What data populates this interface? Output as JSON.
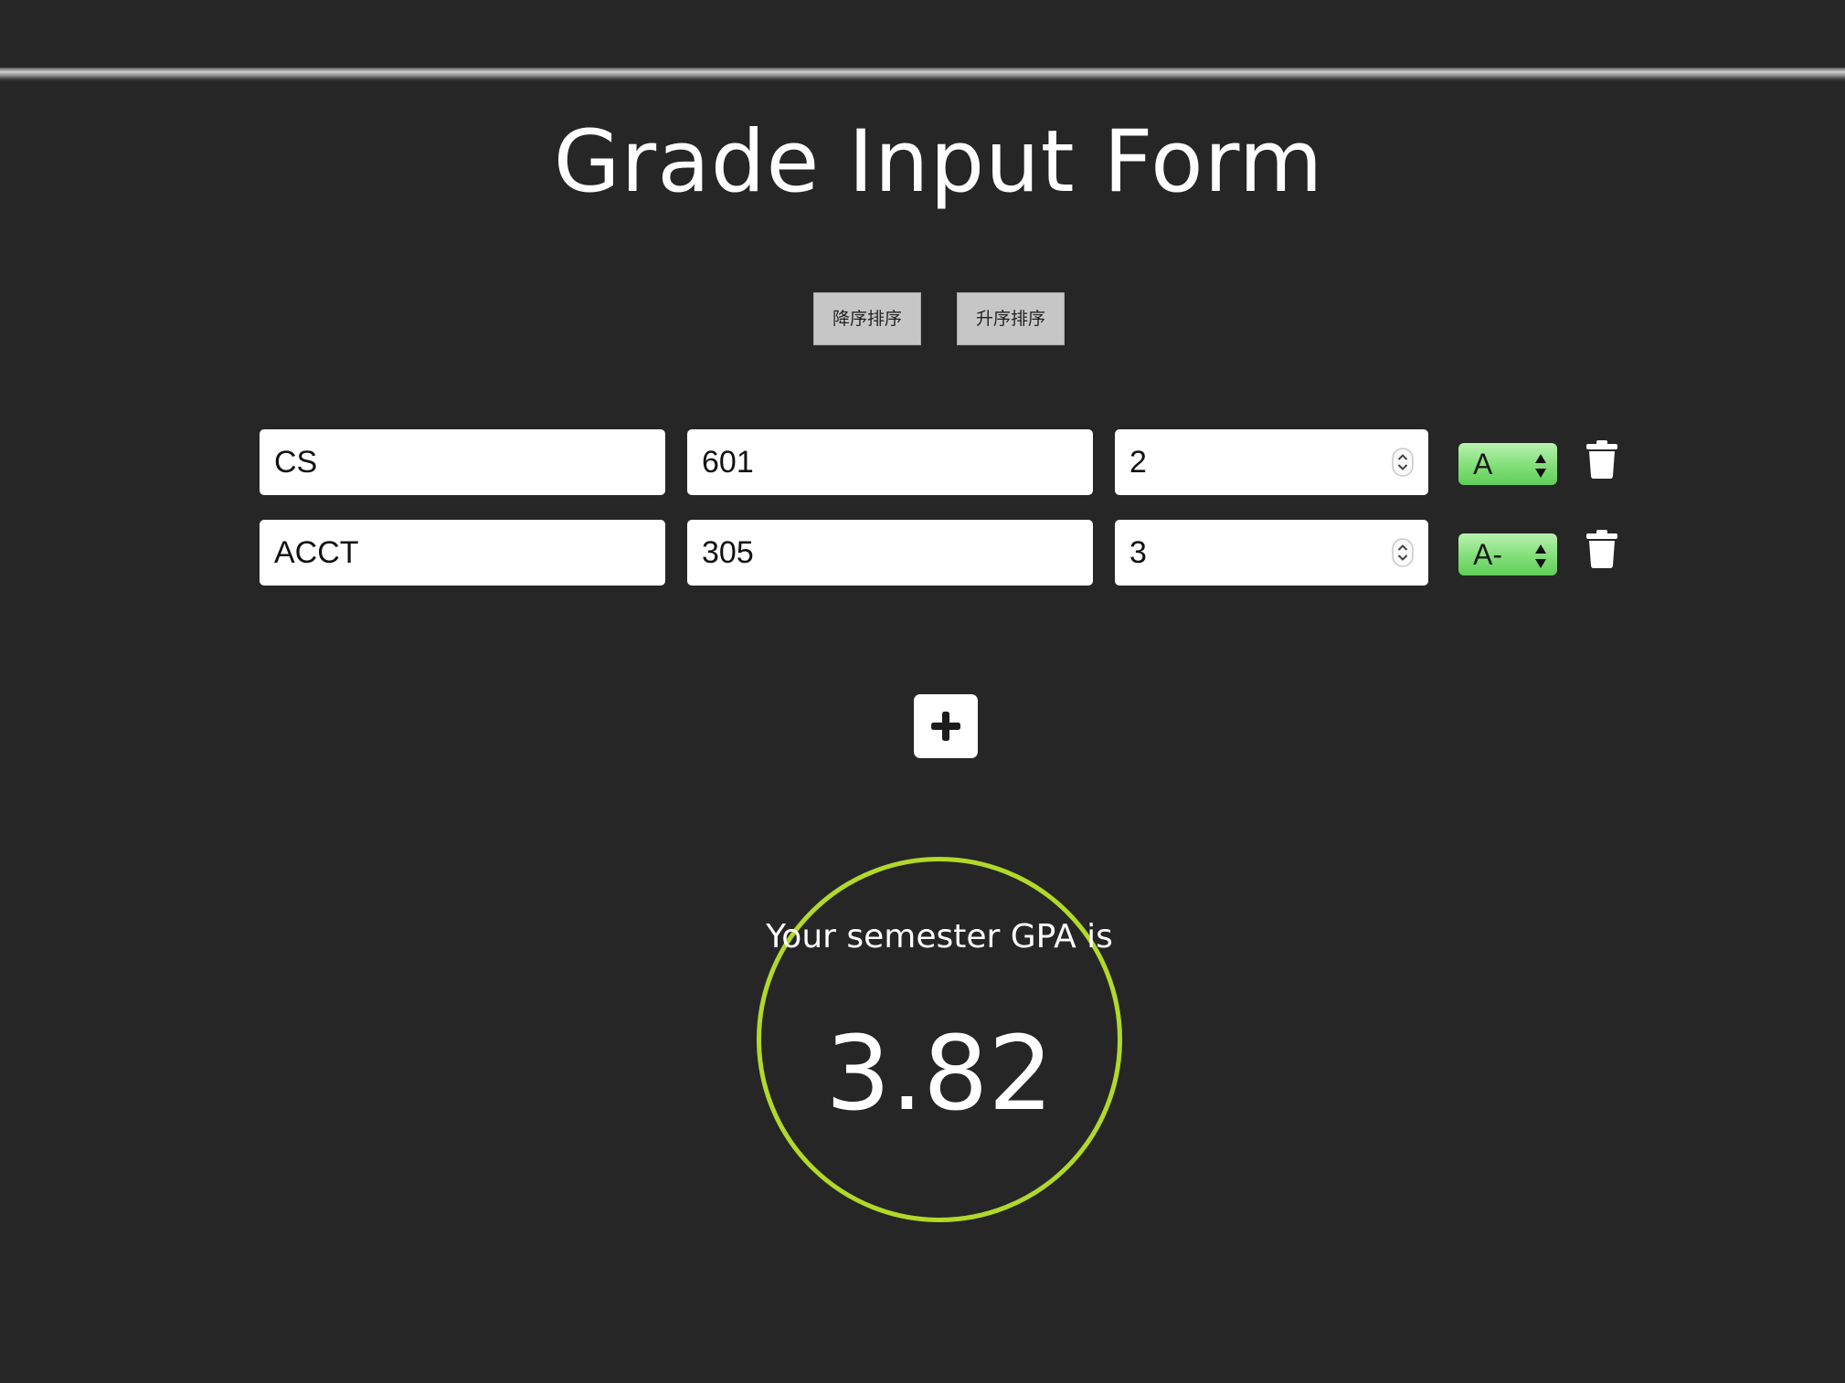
{
  "header": {
    "title": "Grade Input Form"
  },
  "sort": {
    "descending_label": "降序排序",
    "ascending_label": "升序排序"
  },
  "courses": [
    {
      "department": "CS",
      "number": "601",
      "credits": "2",
      "grade": "A"
    },
    {
      "department": "ACCT",
      "number": "305",
      "credits": "3",
      "grade": "A-"
    }
  ],
  "icons": {
    "delete": "trash-icon",
    "add": "plus-icon",
    "stepper": "stepper-icon",
    "select_arrows": "select-arrows-icon"
  },
  "result": {
    "caption": "Your semester GPA is",
    "gpa": "3.82"
  },
  "colors": {
    "background": "#262626",
    "ring": "#b2d82a",
    "grade_select": "#86e07c"
  }
}
